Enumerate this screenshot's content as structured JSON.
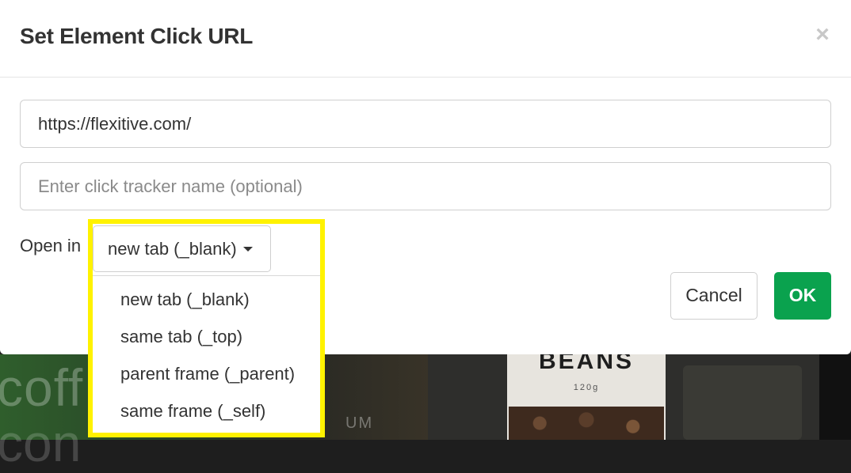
{
  "modal": {
    "title": "Set Element Click URL",
    "close_glyph": "×",
    "url_value": "https://flexitive.com/",
    "tracker_placeholder": "Enter click tracker name (optional)",
    "open_in_label": "Open in",
    "cancel_label": "Cancel",
    "ok_label": "OK"
  },
  "open_in_select": {
    "selected": "new tab (_blank)",
    "options": [
      "new tab (_blank)",
      "same tab (_top)",
      "parent frame (_parent)",
      "same frame (_self)"
    ]
  },
  "background": {
    "word1": "coff",
    "word2": "con",
    "um_text": "UM",
    "bag_brand": "BEANS",
    "bag_weight": "120g"
  },
  "colors": {
    "ok_green": "#0aa24e",
    "highlight_yellow": "#fff200"
  },
  "icons": {
    "close": "close-icon",
    "caret": "caret-down-icon"
  }
}
